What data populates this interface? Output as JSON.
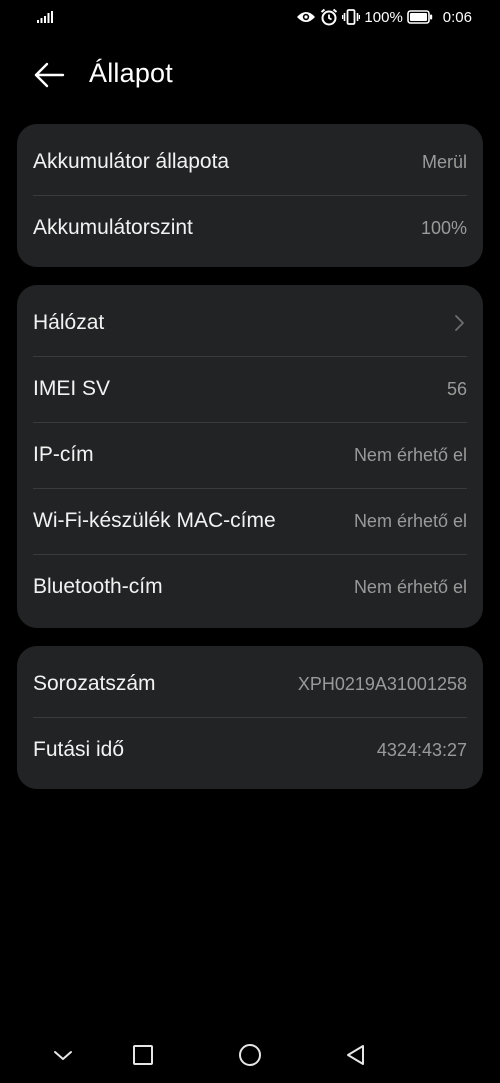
{
  "status_bar": {
    "battery_percent": "100%",
    "time": "0:06",
    "icons": [
      "signal-icon",
      "eye-icon",
      "alarm-icon",
      "vibrate-icon",
      "battery-icon"
    ]
  },
  "header": {
    "title": "Állapot",
    "back_icon": "arrow-left-icon"
  },
  "battery_card": {
    "rows": [
      {
        "label": "Akkumulátor állapota",
        "value": "Merül"
      },
      {
        "label": "Akkumulátorszint",
        "value": "100%"
      }
    ]
  },
  "network_card": {
    "rows": [
      {
        "label": "Hálózat",
        "value": "",
        "icon": "chevron-right-icon"
      },
      {
        "label": "IMEI SV",
        "value": "56"
      },
      {
        "label": "IP-cím",
        "value": "Nem érhető el"
      },
      {
        "label": "Wi-Fi-készülék MAC-címe",
        "value": "Nem érhető el"
      },
      {
        "label": "Bluetooth-cím",
        "value": "Nem érhető el"
      }
    ]
  },
  "device_card": {
    "rows": [
      {
        "label": "Sorozatszám",
        "value": "XPH0219A31001258"
      },
      {
        "label": "Futási idő",
        "value": "4324:43:27"
      }
    ]
  },
  "nav_bar": {
    "buttons": [
      "chevron-down-icon",
      "square-icon",
      "circle-icon",
      "triangle-back-icon"
    ]
  },
  "colors": {
    "background": "#000000",
    "card": "#222324",
    "divider": "#3a3b3d",
    "label": "#f2f2f2",
    "value": "#9a9a9a"
  }
}
